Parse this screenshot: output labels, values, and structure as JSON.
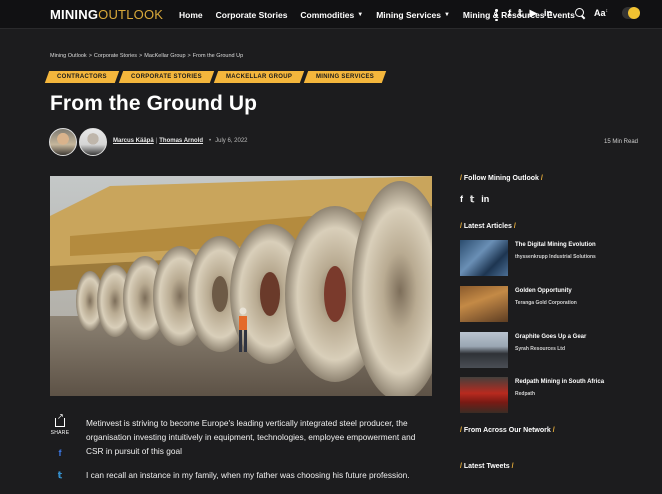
{
  "header": {
    "logo_bold": "MINING",
    "logo_light": "OUTLOOK",
    "nav": [
      {
        "label": "Home",
        "dropdown": false
      },
      {
        "label": "Corporate Stories",
        "dropdown": false
      },
      {
        "label": "Commodities",
        "dropdown": true
      },
      {
        "label": "Mining Services",
        "dropdown": true
      },
      {
        "label": "Mining & Resources Events",
        "dropdown": false
      }
    ],
    "social_icons": [
      "facebook-icon",
      "twitter-icon",
      "youtube-icon",
      "linkedin-icon"
    ],
    "social_glyphs": [
      "f",
      "𝕥",
      "▶",
      "in"
    ],
    "font_size_label": "Aa",
    "accent_color": "#d9a93a"
  },
  "breadcrumb": [
    "Mining Outlook",
    "Corporate Stories",
    "MacKellar Group",
    "From the Ground Up"
  ],
  "tags": [
    "CONTRACTORS",
    "CORPORATE STORIES",
    "MACKELLAR GROUP",
    "MINING SERVICES"
  ],
  "tag_color": "#f4b63c",
  "article": {
    "title": "From the Ground Up",
    "authors": [
      "Marcus Kääpä",
      "Thomas Arnold"
    ],
    "date": "July 6, 2022",
    "read_time": "15 Min Read",
    "hero_image": "haul-truck-tires",
    "paragraphs": [
      "Metinvest is striving to become Europe's leading vertically integrated steel producer, the organisation investing intuitively in equipment, technologies, employee empowerment and CSR in pursuit of this goal",
      "I can recall an instance in my family, when my father was choosing his future profession."
    ]
  },
  "share": {
    "label": "SHARE",
    "buttons": [
      "facebook-icon",
      "twitter-icon"
    ],
    "glyphs": [
      "f",
      "𝕥"
    ]
  },
  "sidebar": {
    "follow": {
      "title": "Follow Mining Outlook",
      "icons": [
        "facebook-icon",
        "twitter-icon",
        "linkedin-icon"
      ],
      "glyphs": [
        "f",
        "𝕥",
        "in"
      ]
    },
    "latest": {
      "title": "Latest Articles",
      "items": [
        {
          "title": "The Digital Mining Evolution",
          "company": "thyssenkrupp Industrial Solutions"
        },
        {
          "title": "Golden Opportunity",
          "company": "Teranga Gold Corporation"
        },
        {
          "title": "Graphite Goes Up a Gear",
          "company": "Syrah Resources Ltd"
        },
        {
          "title": "Redpath Mining in South Africa",
          "company": "Redpath"
        }
      ]
    },
    "network_title": "From Across Our Network",
    "tweets_title": "Latest Tweets"
  }
}
